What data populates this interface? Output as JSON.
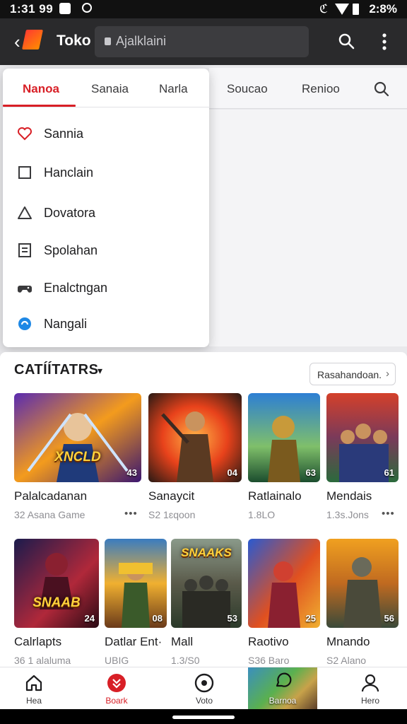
{
  "status_bar": {
    "time": "1:31 99",
    "right_text": "2:8%",
    "cc_text": "ℭ"
  },
  "app_bar": {
    "title": "Toko",
    "search_text": "Ajalklaini"
  },
  "dropdown": {
    "tabs": [
      "Nanoa",
      "Sanaia",
      "Narla"
    ],
    "active_tab": 0,
    "items": [
      {
        "label": "Sannia",
        "icon": "heart-icon"
      },
      {
        "label": "Hanclain",
        "icon": "square-icon"
      },
      {
        "label": "Dovatora",
        "icon": "triangle-icon"
      },
      {
        "label": "Spolahan",
        "icon": "document-icon"
      },
      {
        "label": "Enalctngan",
        "icon": "gamepad-icon"
      },
      {
        "label": "Nangali",
        "icon": "swirl-icon"
      }
    ]
  },
  "background_tabs": [
    "Soucao",
    "Renioo"
  ],
  "section": {
    "title": "CATÍÍTATRS",
    "recommend_label": "Rasahandoan."
  },
  "games": [
    {
      "name": "Palalcadanan",
      "sub": "32 Asana Game",
      "badge": "43",
      "art": "XNCLD",
      "colors": [
        "#f39b1d",
        "#5a2bb0"
      ]
    },
    {
      "name": "Sanaycit",
      "sub": "S2 1ɛqoon",
      "badge": "04",
      "art": "",
      "colors": [
        "#e8421b",
        "#2b1a14"
      ]
    },
    {
      "name": "Ratlainalo",
      "sub": "1.8LO",
      "badge": "63",
      "art": "",
      "colors": [
        "#2d7fd4",
        "#1b4d2e"
      ]
    },
    {
      "name": "Mendais",
      "sub": "1.3s.Jons",
      "badge": "61",
      "art": "",
      "colors": [
        "#d4402a",
        "#2b6a3c"
      ]
    },
    {
      "name": "Calrlapts",
      "sub": "36 1 alaluma",
      "badge": "24",
      "art": "SNAAB",
      "colors": [
        "#1b1b4d",
        "#b0283a"
      ]
    },
    {
      "name": "Datlar Ent·",
      "sub": "UBIG",
      "badge": "08",
      "art": "",
      "colors": [
        "#f0b030",
        "#3a7cc0"
      ]
    },
    {
      "name": "Mall",
      "sub": "1.3/S0",
      "badge": "53",
      "art": "SNAAKS",
      "colors": [
        "#5a5a4a",
        "#2b3a2a"
      ]
    },
    {
      "name": "Raotivo",
      "sub": "S36 Baro",
      "badge": "25",
      "art": "",
      "colors": [
        "#2a5ad0",
        "#e05020"
      ]
    },
    {
      "name": "Mnando",
      "sub": "S2 Alano",
      "badge": "56",
      "art": "",
      "colors": [
        "#f0a020",
        "#3a4a3a"
      ]
    }
  ],
  "bottom_nav": [
    {
      "label": "Hea",
      "icon": "home-icon"
    },
    {
      "label": "Boark",
      "icon": "bookmark-icon"
    },
    {
      "label": "Voto",
      "icon": "circle-icon"
    },
    {
      "label": "Barnoa",
      "icon": "chat-icon"
    },
    {
      "label": "Hero",
      "icon": "profile-icon"
    }
  ],
  "accent_color": "#d81f26"
}
